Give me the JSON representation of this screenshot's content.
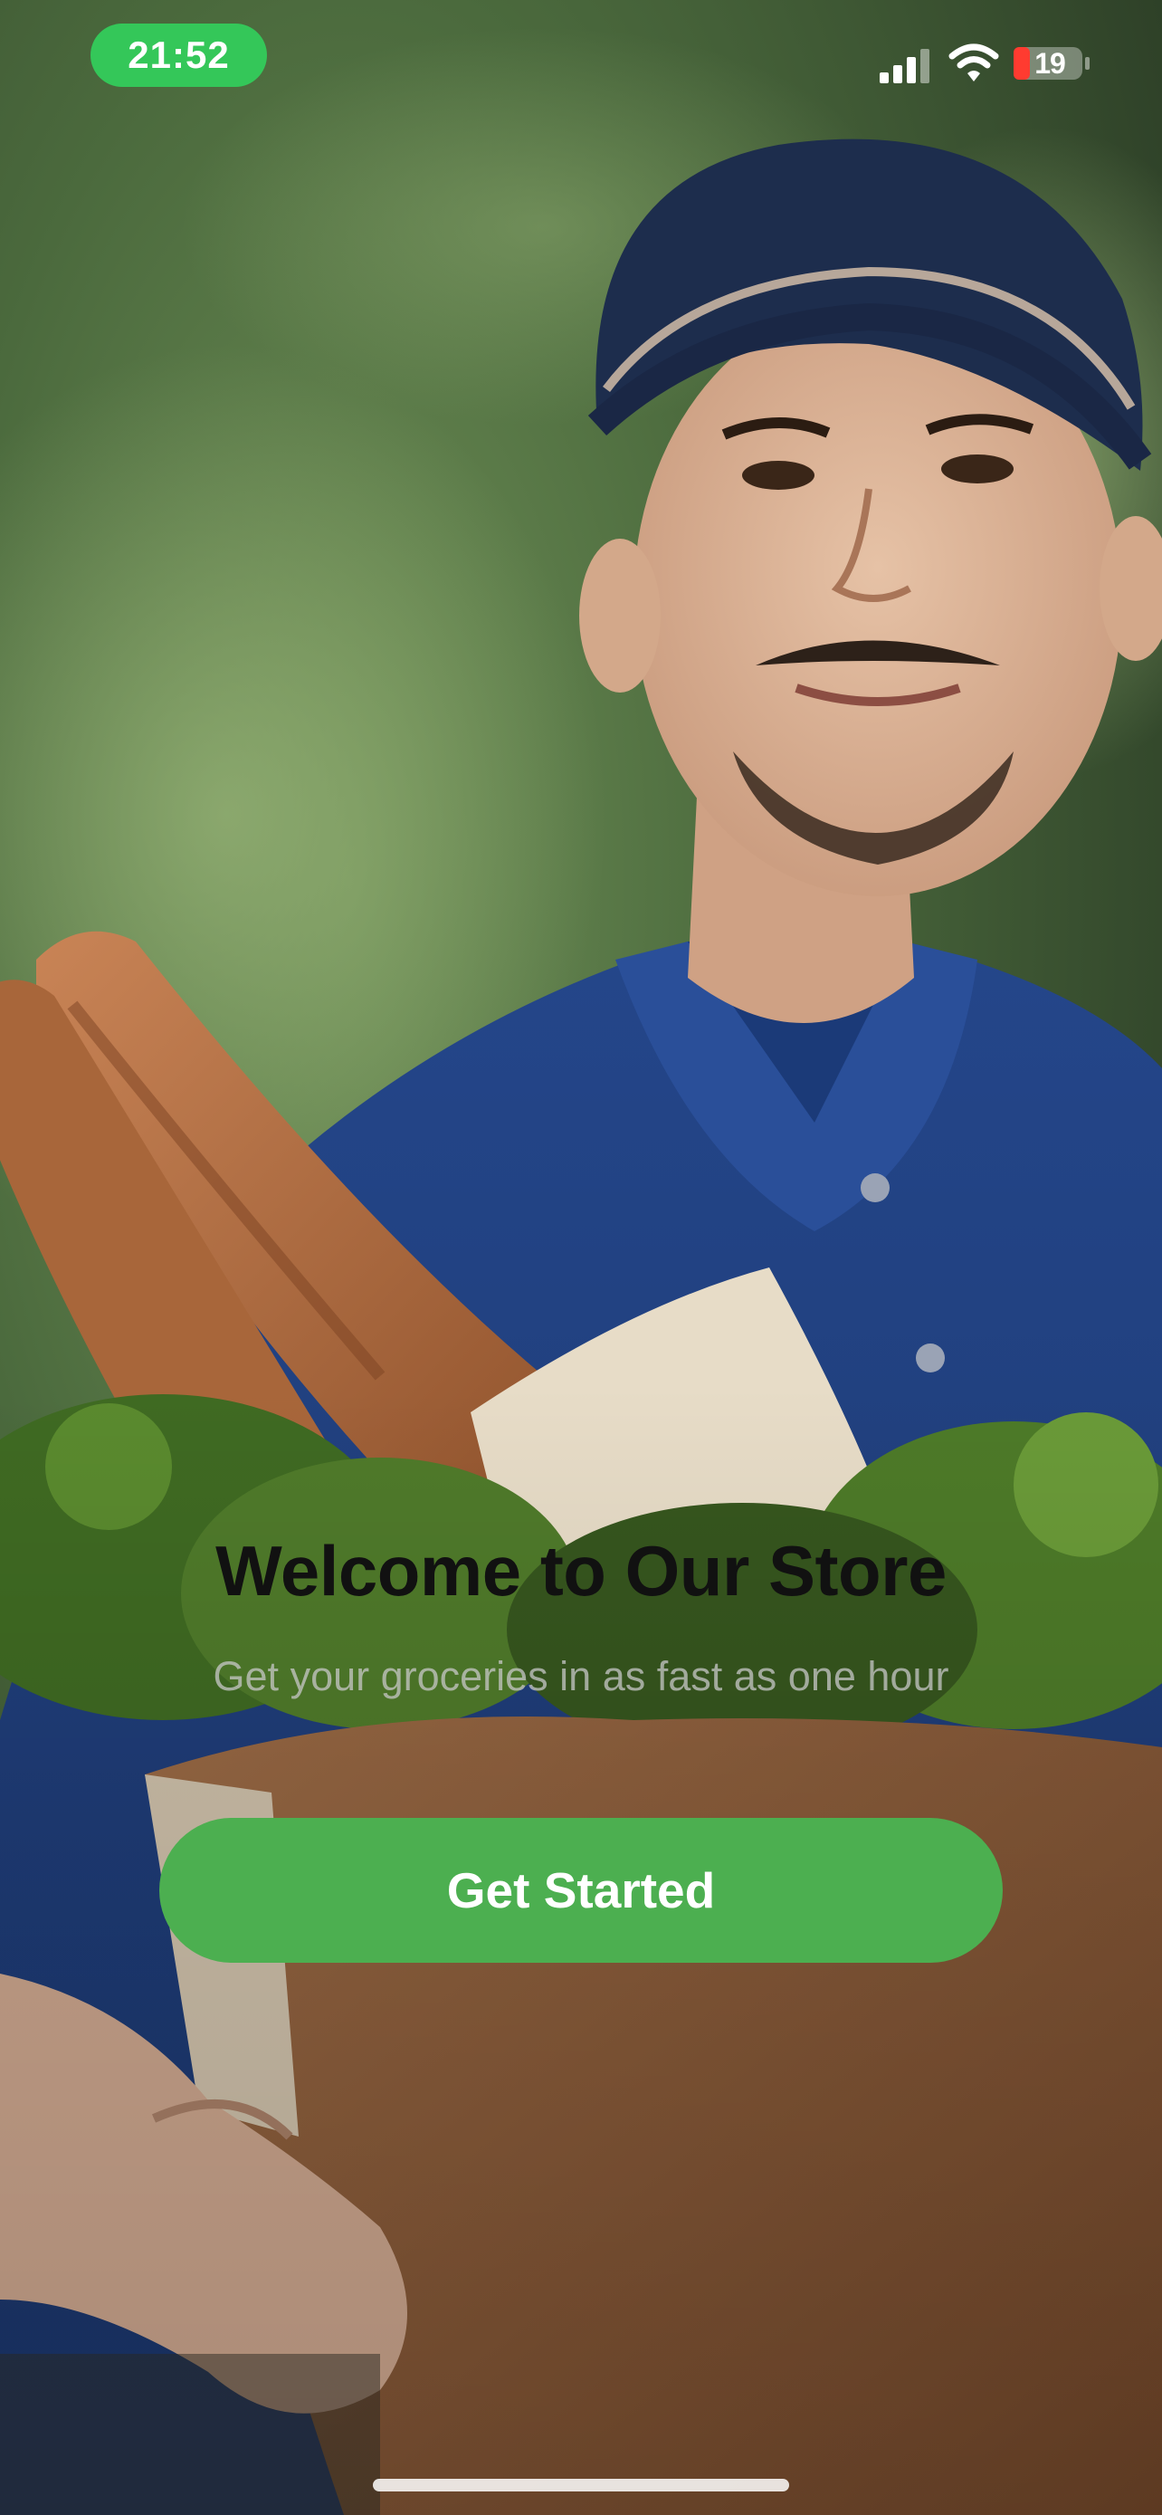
{
  "status_bar": {
    "time": "21:52",
    "battery": "19"
  },
  "welcome": {
    "title": "Welcome to Our Store",
    "subtitle": "Get your groceries in as fast as one hour",
    "cta_label": "Get Started"
  },
  "colors": {
    "accent": "#4caf50",
    "time_pill": "#34c759"
  }
}
